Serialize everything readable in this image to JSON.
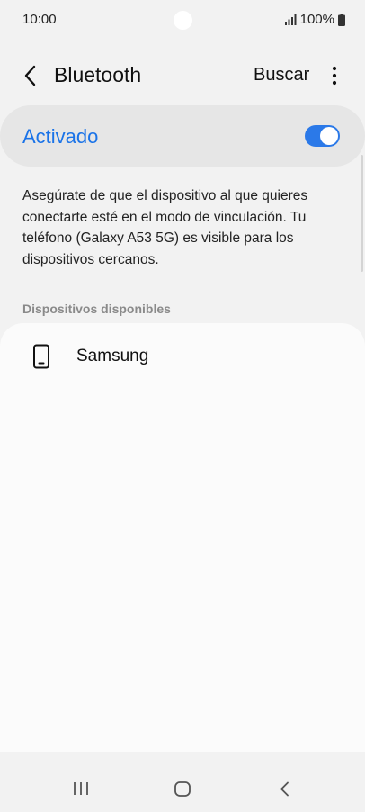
{
  "status_bar": {
    "time": "10:00",
    "battery": "100%"
  },
  "app_bar": {
    "title": "Bluetooth",
    "search_label": "Buscar"
  },
  "master_switch": {
    "label": "Activado",
    "state": "on"
  },
  "info": {
    "text": "Asegúrate de que el dispositivo al que quieres conectarte esté en el modo de vinculación. Tu teléfono (Galaxy A53 5G) es visible para los dispositivos cercanos."
  },
  "available_devices": {
    "header": "Dispositivos disponibles",
    "items": [
      {
        "name": "Samsung",
        "icon": "phone-icon"
      }
    ]
  },
  "colors": {
    "accent": "#1a73e8",
    "toggle_on": "#2b79e8",
    "background": "#f2f2f2"
  }
}
